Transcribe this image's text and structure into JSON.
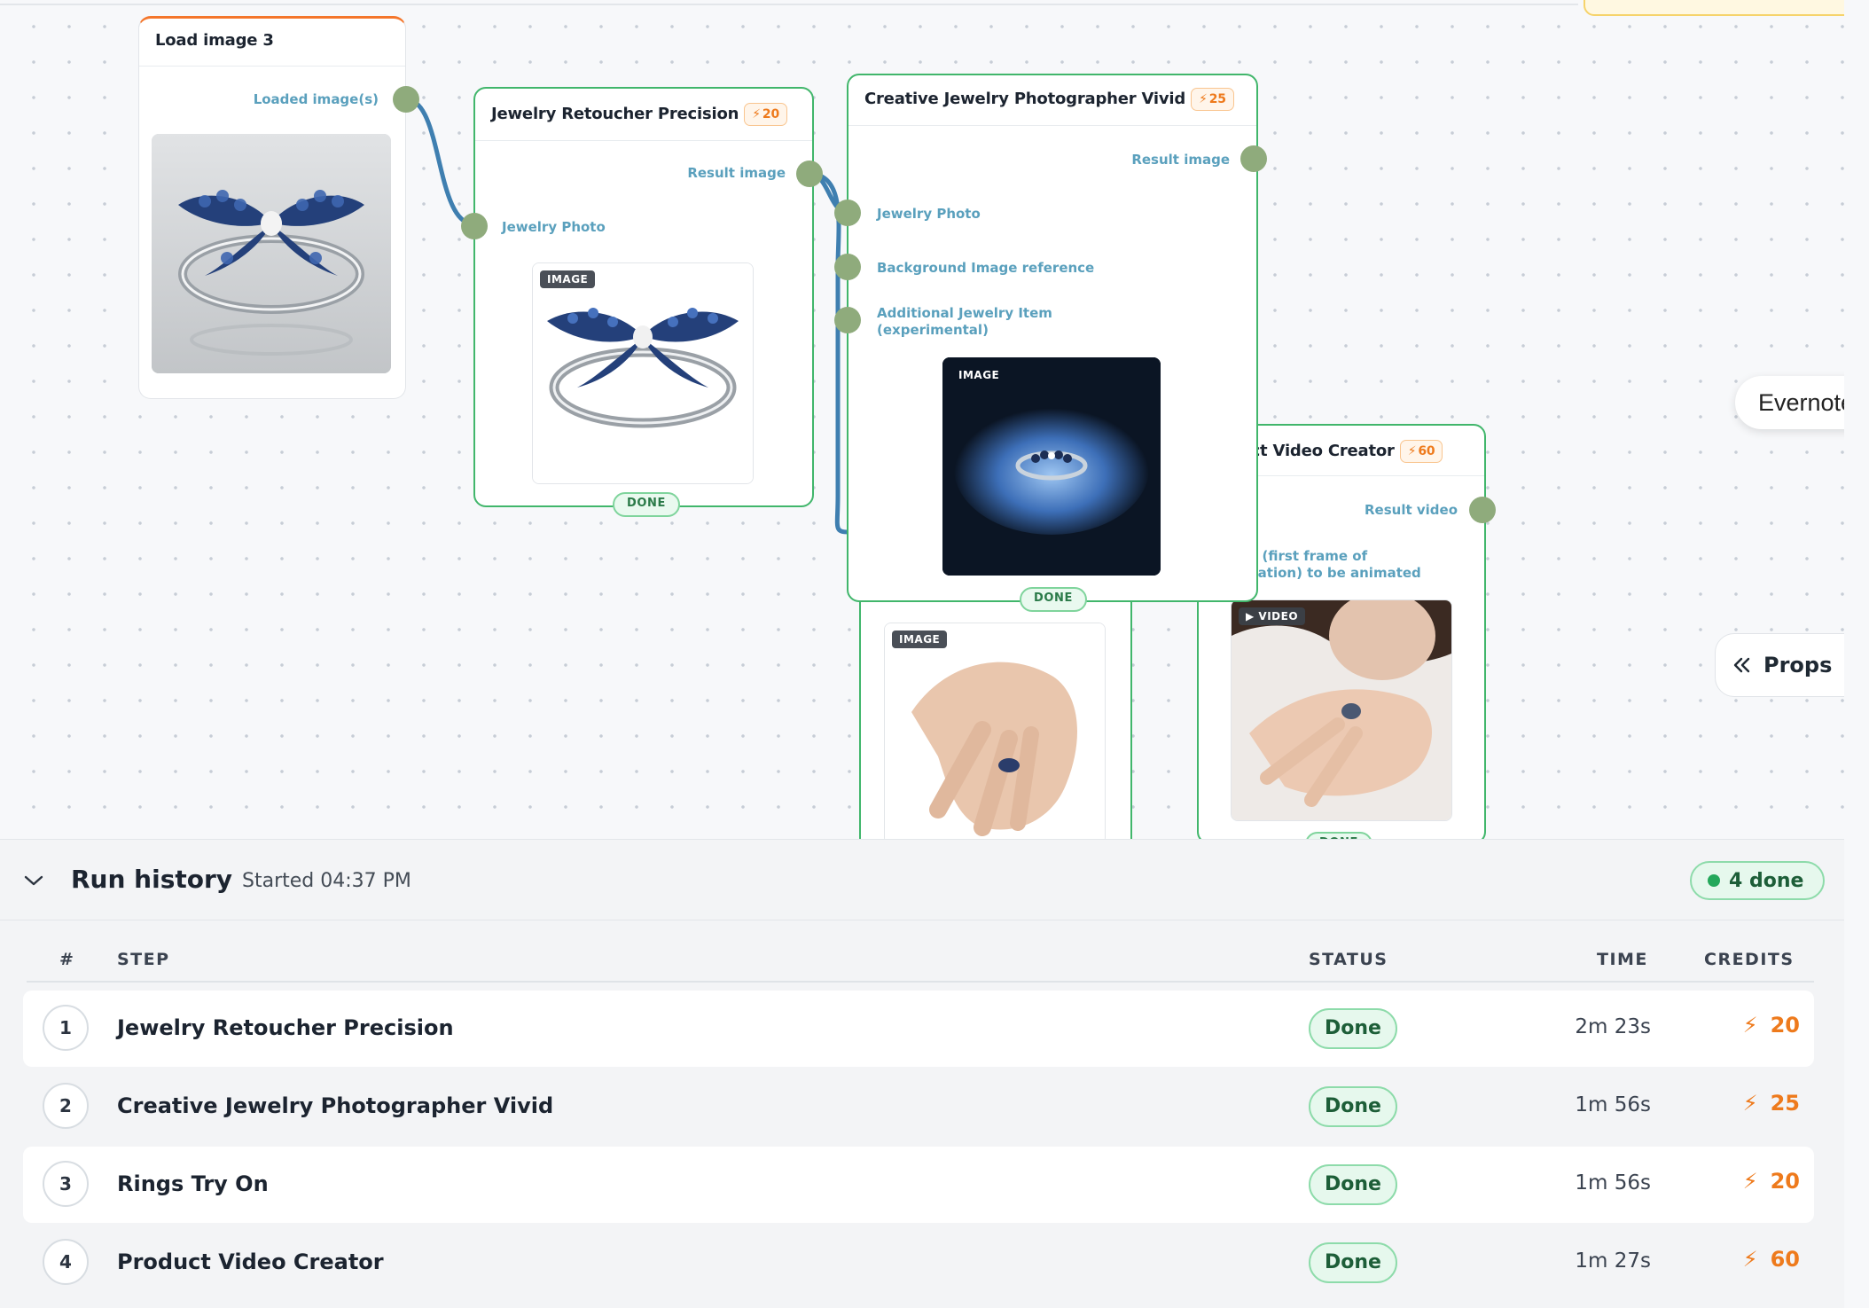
{
  "canvas": {
    "nodes": {
      "load_image": {
        "title": "Load image 3",
        "outputs": [
          "Loaded image(s)"
        ]
      },
      "retoucher": {
        "title": "Jewelry Retoucher Precision",
        "cost": "20",
        "outputs": [
          "Result image"
        ],
        "inputs": [
          "Jewelry Photo"
        ],
        "image_chip": "IMAGE",
        "status": "DONE"
      },
      "photographer": {
        "title": "Creative Jewelry Photographer Vivid",
        "cost": "25",
        "outputs": [
          "Result image"
        ],
        "inputs": [
          "Jewelry Photo",
          "Background Image reference",
          "Additional Jewelry Item",
          "(experimental)"
        ],
        "image_chip": "IMAGE",
        "status": "DONE"
      },
      "try_on": {
        "image_chip": "IMAGE"
      },
      "video_creator": {
        "title": "luct Video Creator",
        "cost": "60",
        "outputs": [
          "Result video"
        ],
        "inputs": [
          "o (first frame of",
          "nation) to be animated"
        ],
        "image_chip": "▶ VIDEO",
        "status": "DONE"
      }
    },
    "side_tabs": {
      "evernote": "Evernote",
      "props": "Props"
    }
  },
  "run_history": {
    "title": "Run history",
    "started": "Started 04:37 PM",
    "summary": "4 done",
    "columns": {
      "num": "#",
      "step": "STEP",
      "status": "STATUS",
      "time": "TIME",
      "credits": "CREDITS"
    },
    "rows": [
      {
        "num": "1",
        "step": "Jewelry Retoucher Precision",
        "status": "Done",
        "time": "2m 23s",
        "credits": "20"
      },
      {
        "num": "2",
        "step": "Creative Jewelry Photographer Vivid",
        "status": "Done",
        "time": "1m 56s",
        "credits": "25"
      },
      {
        "num": "3",
        "step": "Rings Try On",
        "status": "Done",
        "time": "1m 56s",
        "credits": "20"
      },
      {
        "num": "4",
        "step": "Product Video Creator",
        "status": "Done",
        "time": "1m 27s",
        "credits": "60"
      }
    ]
  },
  "colors": {
    "accent_green": "#41b66b",
    "credit_orange": "#ee7a1c",
    "wire_blue": "#3f7fb0",
    "port_green": "#8fab7c"
  }
}
